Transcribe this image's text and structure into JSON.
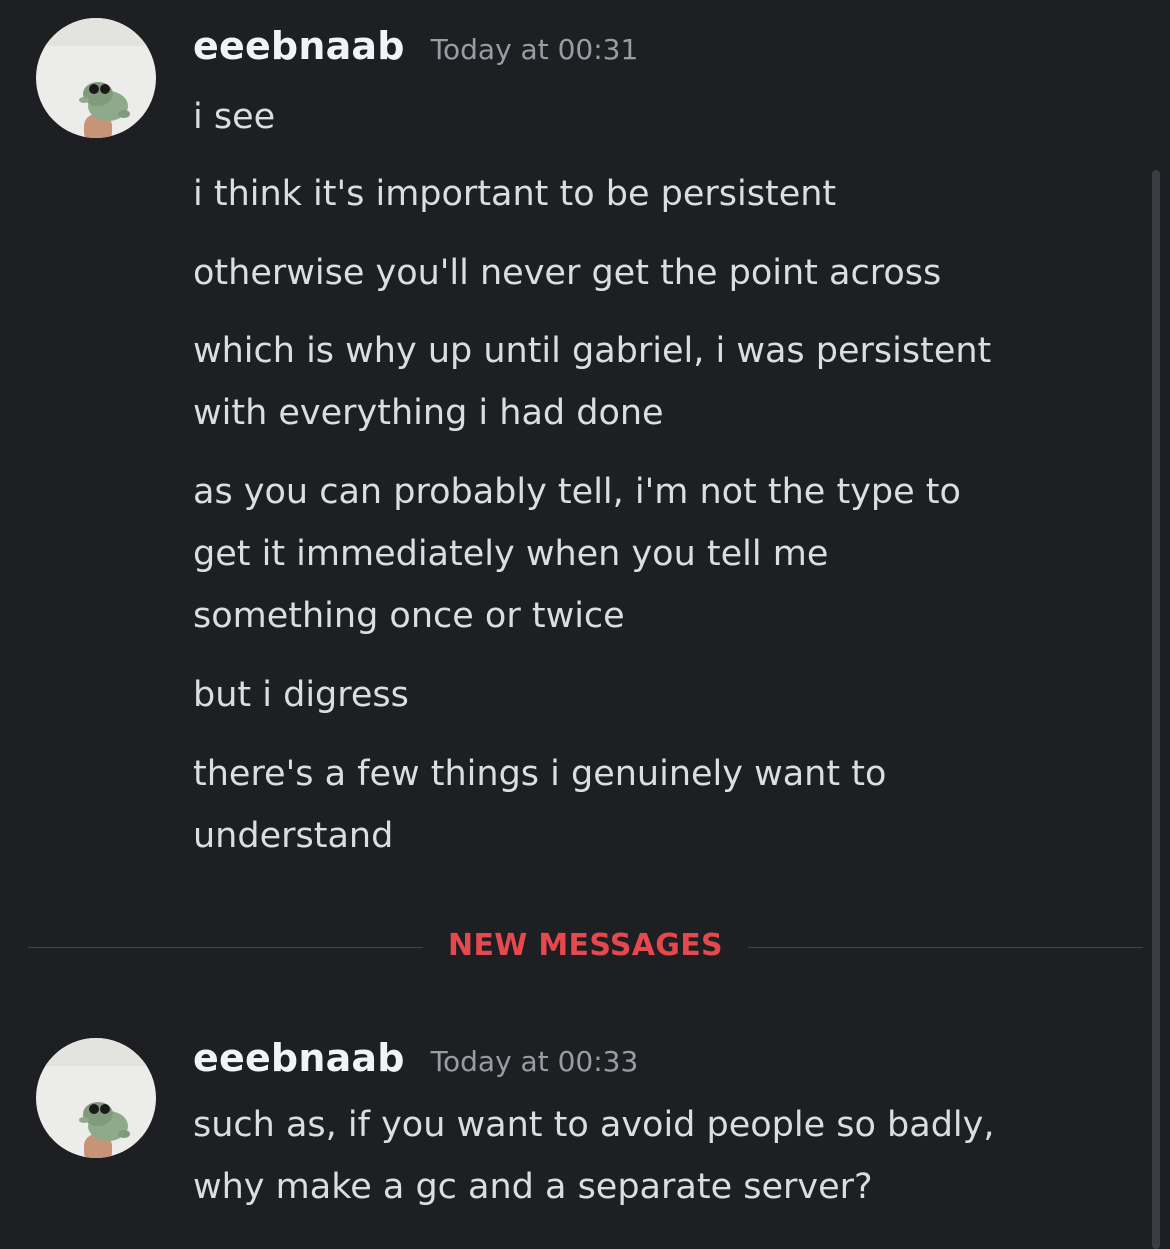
{
  "messages": [
    {
      "author": "eeebnaab",
      "timestamp": "Today at 00:31",
      "lines": [
        "i see",
        "i think it's important to be persistent",
        "otherwise you'll never get the point across",
        "which is why up until gabriel, i was persistent\nwith everything i had done",
        "as you can probably tell, i'm not the type to\nget it immediately when you tell me\nsomething once or twice",
        "but i digress",
        "there's a few things i genuinely want to\nunderstand"
      ]
    },
    {
      "author": "eeebnaab",
      "timestamp": "Today at 00:33",
      "lines": [
        "such as, if you want to avoid people so badly,\nwhy make a gc and a separate server?"
      ]
    }
  ],
  "divider": {
    "label": "NEW MESSAGES",
    "color": "#e5484d"
  },
  "colors": {
    "background": "#1e1f22",
    "username": "#f2f3f5",
    "timestamp": "#9b9ca3",
    "message_text": "#dbdee1"
  },
  "icons": {
    "avatar": "frog-on-finger-avatar"
  }
}
